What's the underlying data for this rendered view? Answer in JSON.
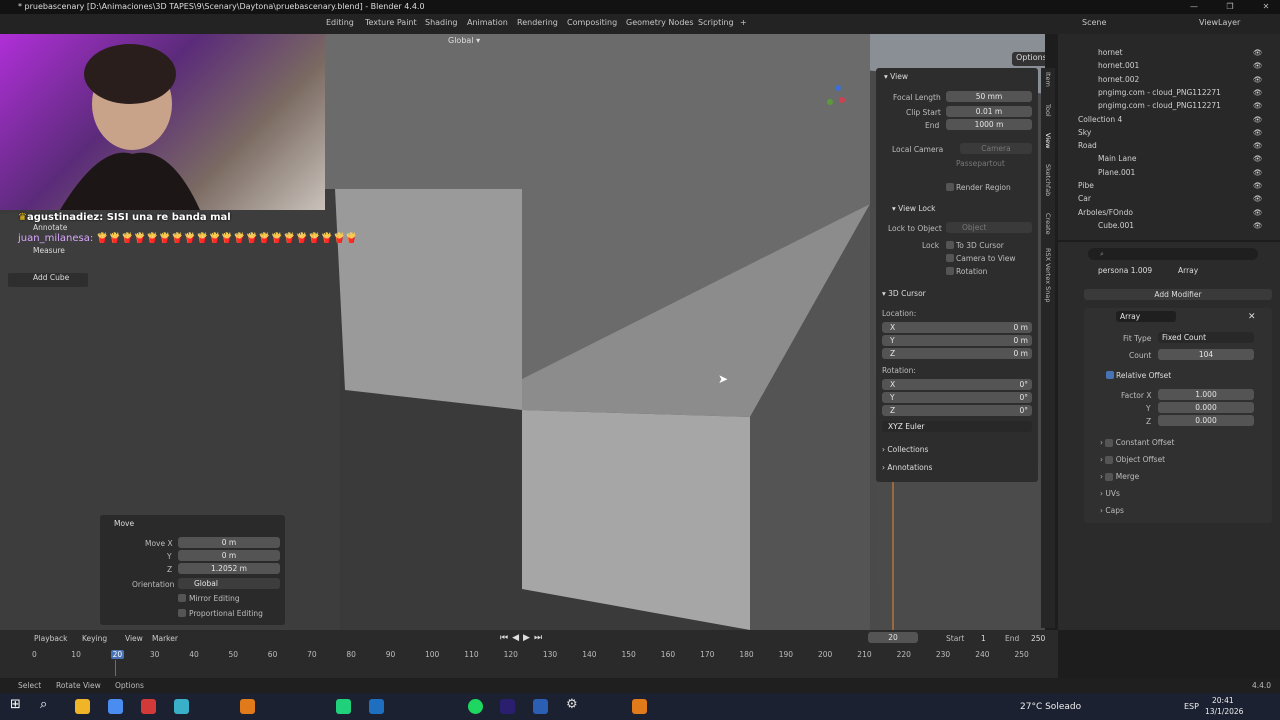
{
  "window": {
    "title": "* pruebascenary [D:\\Animaciones\\3D TAPES\\9\\Scenary\\Daytona\\pruebascenary.blend] - Blender 4.4.0",
    "minimize": "—",
    "maximize": "❐",
    "close": "✕"
  },
  "workspaces": [
    "Editing",
    "Texture Paint",
    "Shading",
    "Animation",
    "Rendering",
    "Compositing",
    "Geometry Nodes",
    "Scripting",
    "+"
  ],
  "scene": {
    "label": "Scene",
    "view_layer": "ViewLayer"
  },
  "viewport_header": {
    "orientation": "Global",
    "options": "Options"
  },
  "overlay": {
    "chat": [
      {
        "user": "agustinadiez",
        "message": "SISI una re banda mal"
      },
      {
        "user": "juan_milanesa",
        "message": "🍟🍟🍟🍟🍟🍟🍟🍟🍟🍟🍟🍟🍟🍟🍟🍟🍟🍟🍟🍟🍟"
      }
    ]
  },
  "toolbar": {
    "annotate": "Annotate",
    "measure": "Measure",
    "add_cube": "Add Cube"
  },
  "move_panel": {
    "title": "Move",
    "move_x_label": "Move X",
    "move_x": "0 m",
    "y_label": "Y",
    "y": "0 m",
    "z_label": "Z",
    "z": "1.2052 m",
    "orientation_label": "Orientation",
    "orientation": "Global",
    "mirror": "Mirror Editing",
    "proportional": "Proportional Editing"
  },
  "npanel": {
    "view": {
      "title": "View",
      "focal_length_label": "Focal Length",
      "focal_length": "50 mm",
      "clip_start_label": "Clip Start",
      "clip_start": "0.01 m",
      "end_label": "End",
      "end": "1000 m",
      "local_camera_label": "Local Camera",
      "camera": "Camera",
      "passepartout": "Passepartout",
      "render_region": "Render Region"
    },
    "view_lock": {
      "title": "View Lock",
      "lock_to_object_label": "Lock to Object",
      "object_placeholder": "Object",
      "lock_label": "Lock",
      "to_3d_cursor": "To 3D Cursor",
      "camera_to_view": "Camera to View",
      "rotation": "Rotation"
    },
    "cursor": {
      "title": "3D Cursor",
      "location": "Location:",
      "x": "0 m",
      "y": "0 m",
      "z": "0 m",
      "rotation": "Rotation:",
      "rx": "0°",
      "ry": "0°",
      "rz": "0°",
      "mode": "XYZ Euler",
      "X": "X",
      "Y": "Y",
      "Z": "Z"
    },
    "collections": "Collections",
    "annotations": "Annotations",
    "tabs": [
      "Item",
      "Tool",
      "View",
      "Sketchfab",
      "Create",
      "RSX Vertex Snap"
    ]
  },
  "outliner": {
    "items": [
      {
        "name": "hornet",
        "indent": 3
      },
      {
        "name": "hornet.001",
        "indent": 3
      },
      {
        "name": "hornet.002",
        "indent": 3
      },
      {
        "name": "pngimg.com - cloud_PNG112271",
        "indent": 3
      },
      {
        "name": "pngimg.com - cloud_PNG112271",
        "indent": 3
      },
      {
        "name": "Collection 4",
        "indent": 1
      },
      {
        "name": "Sky",
        "indent": 1
      },
      {
        "name": "Road",
        "indent": 1
      },
      {
        "name": "Main Lane",
        "indent": 3
      },
      {
        "name": "Plane.001",
        "indent": 3
      },
      {
        "name": "Pibe",
        "indent": 1
      },
      {
        "name": "Car",
        "indent": 1
      },
      {
        "name": "Arboles/FOndo",
        "indent": 1
      },
      {
        "name": "Cube.001",
        "indent": 3
      }
    ]
  },
  "properties": {
    "object": "persona 1.009",
    "modifier_tab": "Array",
    "add_modifier": "Add Modifier",
    "modifier_name": "Array",
    "fit_type_label": "Fit Type",
    "fit_type": "Fixed Count",
    "count_label": "Count",
    "count": "104",
    "relative_offset": "Relative Offset",
    "factor_x_label": "Factor X",
    "factor_x": "1.000",
    "y_label": "Y",
    "factor_y": "0.000",
    "z_label": "Z",
    "factor_z": "0.000",
    "constant_offset": "Constant Offset",
    "object_offset": "Object Offset",
    "merge": "Merge",
    "uvs": "UVs",
    "caps": "Caps"
  },
  "timeline": {
    "menus": [
      "Playback",
      "Keying",
      "View",
      "Marker"
    ],
    "current_frame": "20",
    "start_label": "Start",
    "start": "1",
    "end_label": "End",
    "end": "250",
    "ticks": [
      "0",
      "10",
      "20",
      "30",
      "40",
      "50",
      "60",
      "70",
      "80",
      "90",
      "100",
      "110",
      "120",
      "130",
      "140",
      "150",
      "160",
      "170",
      "180",
      "190",
      "200",
      "210",
      "220",
      "230",
      "240",
      "250"
    ]
  },
  "status": {
    "select": "Select",
    "rotate": "Rotate View",
    "options": "Options",
    "version": "4.4.0"
  },
  "taskbar": {
    "weather": "27°C  Soleado",
    "lang": "ESP",
    "time": "20:41",
    "date": "13/1/2026"
  }
}
